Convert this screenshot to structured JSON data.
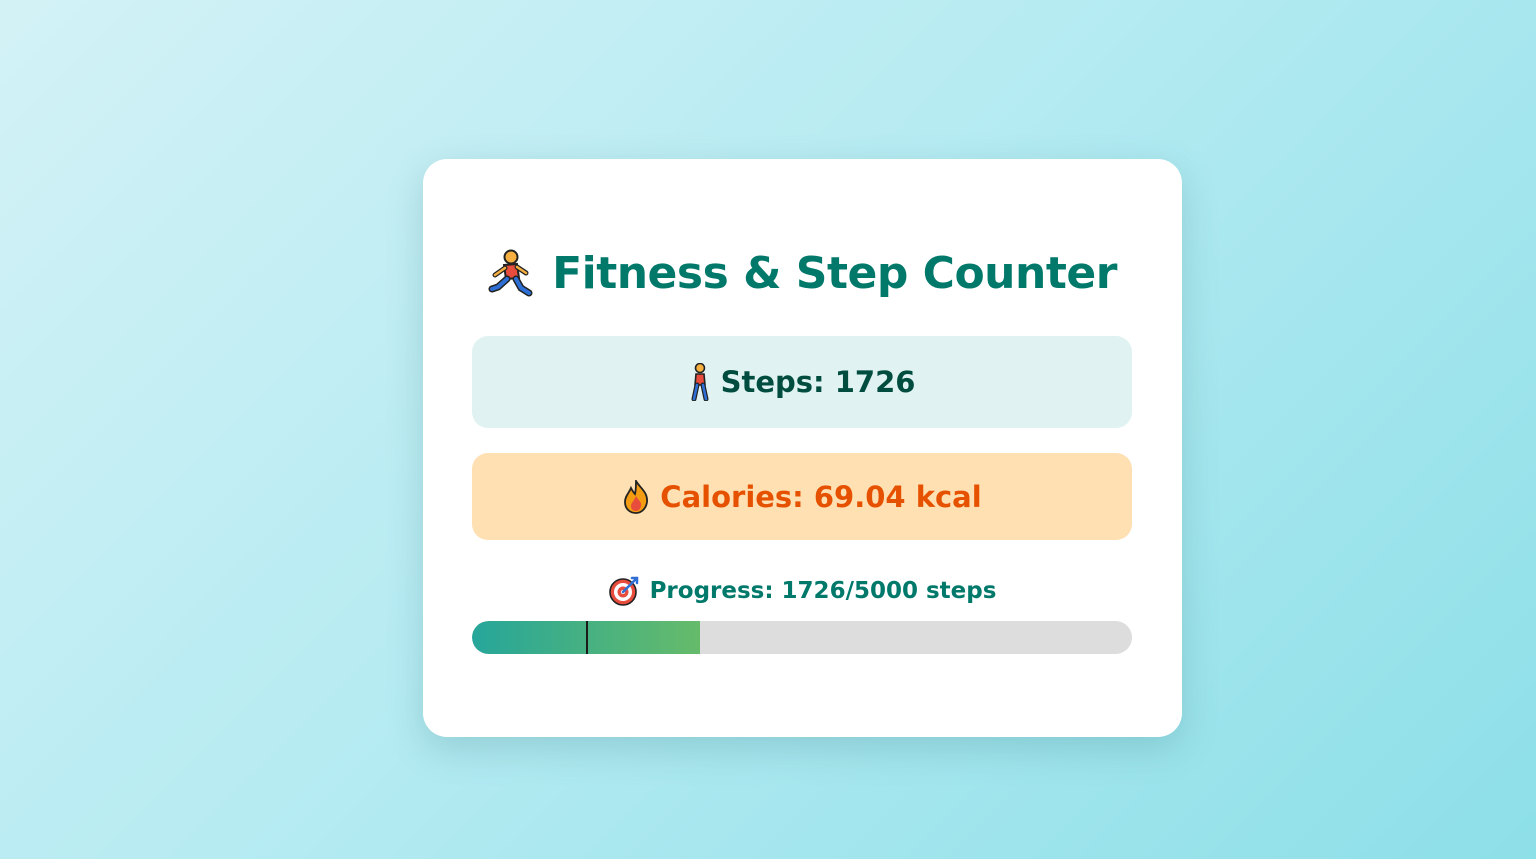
{
  "app": {
    "title": "Fitness & Step Counter",
    "title_icon": "running-person-icon"
  },
  "stats": {
    "steps": {
      "icon": "walking-person-icon",
      "text": "Steps: 1726",
      "value": 1726
    },
    "calories": {
      "icon": "fire-icon",
      "text": "Calories: 69.04 kcal",
      "value": 69.04,
      "unit": "kcal"
    }
  },
  "progress": {
    "icon": "target-icon",
    "text": "Progress: 1726/5000 steps",
    "current": 1726,
    "goal": 5000,
    "fill_fraction": 0.345,
    "marker_fraction": 0.1726
  },
  "colors": {
    "accent": "#00796b",
    "steps_bg": "#e0f2f1",
    "steps_text": "#004d40",
    "calories_bg": "#ffe0b2",
    "calories_text": "#e65100",
    "progress_start": "#26a69a",
    "progress_end": "#66bb6a",
    "track": "#dddddd"
  }
}
